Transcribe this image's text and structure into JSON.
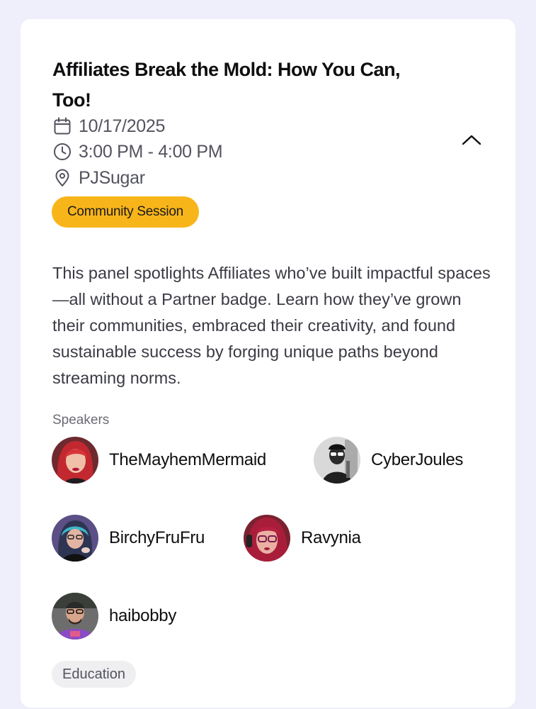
{
  "event": {
    "title": "Affiliates Break the Mold: How You Can, Too!",
    "date": "10/17/2025",
    "time": "3:00 PM - 4:00 PM",
    "location": "PJSugar",
    "session_type": "Community Session",
    "description": "This panel spotlights Affiliates who’ve built impactful spaces—all without a Partner badge. Learn how they’ve grown their communities, embraced their creativity, and found sustainable success by forging unique paths beyond streaming norms.",
    "speakers_label": "Speakers",
    "speakers": [
      {
        "name": "TheMayhemMermaid"
      },
      {
        "name": "CyberJoules"
      },
      {
        "name": "BirchyFruFru"
      },
      {
        "name": "Ravynia"
      },
      {
        "name": "haibobby"
      }
    ],
    "tags": [
      "Education"
    ]
  },
  "icons": {
    "date": "calendar-icon",
    "time": "clock-icon",
    "location": "location-pin-icon",
    "collapse": "chevron-up-icon"
  },
  "colors": {
    "badge_background": "#f8b51a",
    "tag_background": "#efeff1",
    "page_background": "#efeffb"
  }
}
